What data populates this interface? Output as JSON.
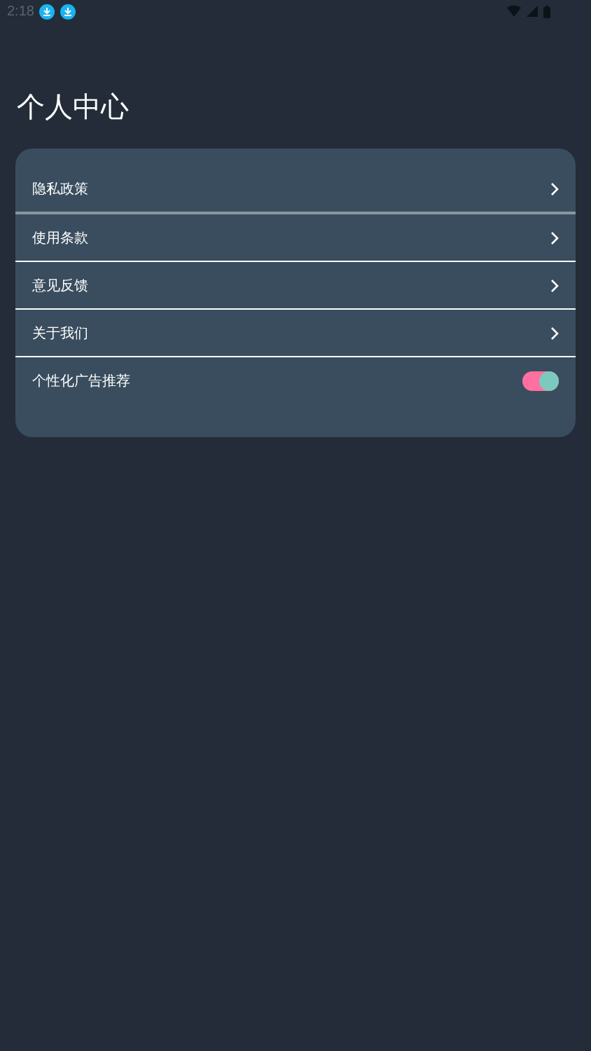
{
  "status_bar": {
    "time": "2:18"
  },
  "title": "个人中心",
  "menu": [
    {
      "kind": "link",
      "label": "隐私政策"
    },
    {
      "kind": "link",
      "label": "使用条款"
    },
    {
      "kind": "link",
      "label": "意见反馈"
    },
    {
      "kind": "link",
      "label": "关于我们"
    },
    {
      "kind": "toggle",
      "label": "个性化广告推荐",
      "on": true
    }
  ]
}
